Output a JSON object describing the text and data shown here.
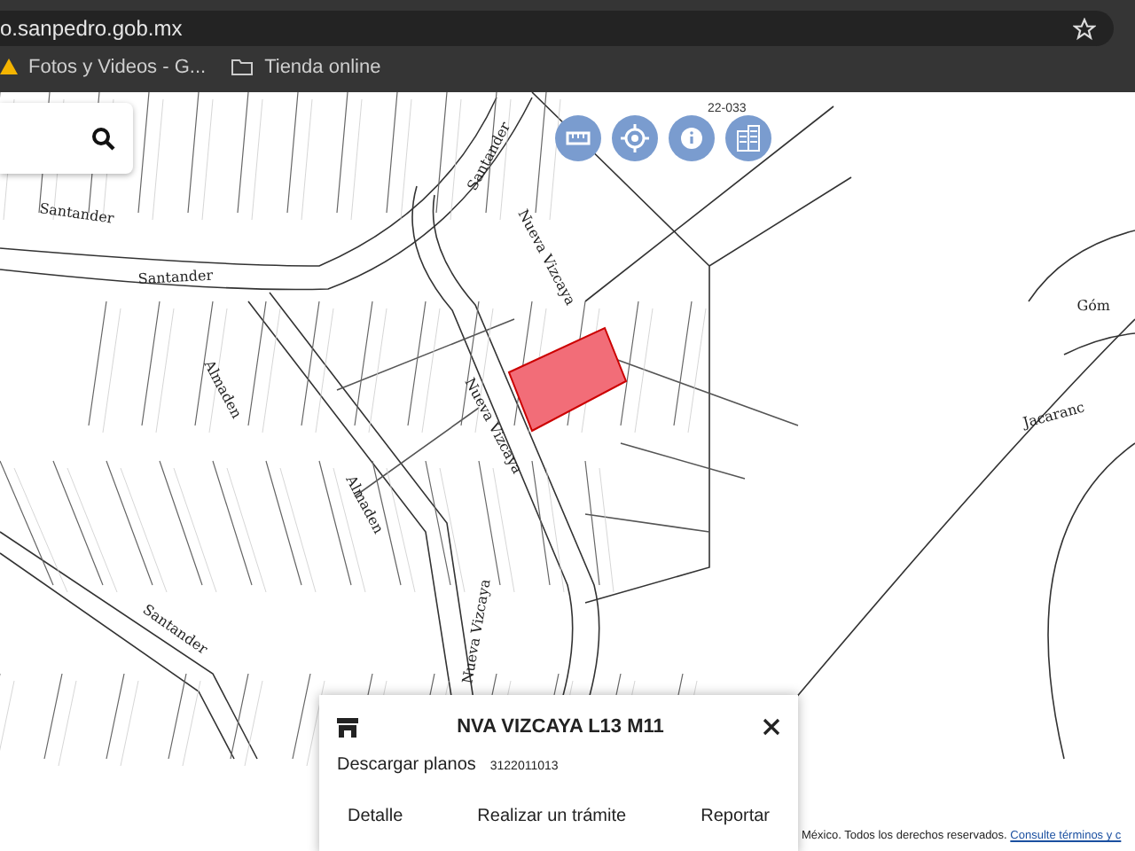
{
  "browser": {
    "url": "o.sanpedro.gob.mx",
    "bookmarks": [
      {
        "label": "Fotos y Videos - G...",
        "kind": "photos"
      },
      {
        "label": "Tienda online",
        "kind": "folder"
      }
    ]
  },
  "map": {
    "search": {
      "kind": "search"
    },
    "tools": [
      {
        "kind": "ruler"
      },
      {
        "kind": "locate"
      },
      {
        "kind": "info"
      },
      {
        "kind": "buildings"
      }
    ],
    "tool_caption": "22-033",
    "street_labels": [
      {
        "text": "Santander"
      },
      {
        "text": "Santander"
      },
      {
        "text": "Santander"
      },
      {
        "text": "Nueva Vizcaya"
      },
      {
        "text": "Almaden"
      },
      {
        "text": "Almaden"
      },
      {
        "text": "Nueva Vizcaya"
      },
      {
        "text": "Santander"
      },
      {
        "text": "Nueva Vizcaya"
      },
      {
        "text": "Góm"
      },
      {
        "text": "Jacaranc"
      }
    ],
    "selected_parcel": true
  },
  "panel": {
    "title": "NVA VIZCAYA L13 M11",
    "download_label": "Descargar planos",
    "plan_number": "3122011013",
    "actions": [
      "Detalle",
      "Realizar un trámite",
      "Reportar"
    ]
  },
  "footer": {
    "text": "México. Todos los derechos reservados.",
    "link": "Consulte términos y c"
  }
}
